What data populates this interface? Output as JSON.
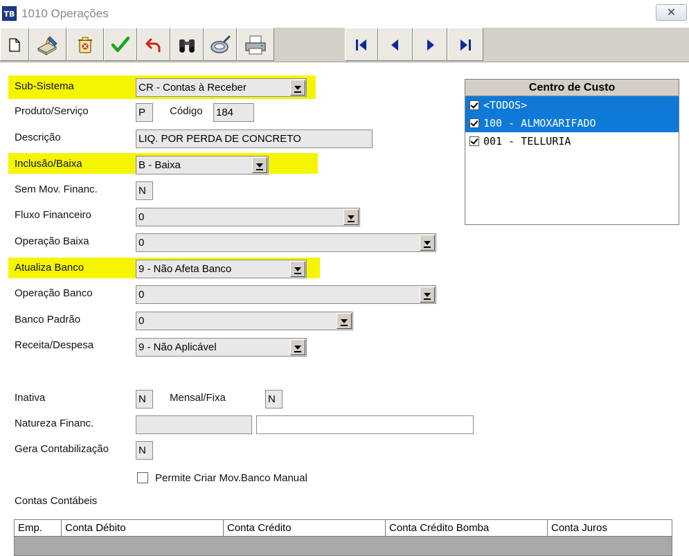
{
  "window": {
    "title": "1010 Operações",
    "app_icon_text": "TB",
    "close_symbol": "✕"
  },
  "toolbar": {
    "buttons": [
      {
        "name": "new-document-icon"
      },
      {
        "name": "edit-icon"
      },
      {
        "name": "delete-icon"
      },
      {
        "name": "confirm-check-icon"
      },
      {
        "name": "undo-icon"
      },
      {
        "name": "search-binoculars-icon"
      },
      {
        "name": "lookup-icon"
      },
      {
        "name": "print-icon"
      }
    ],
    "nav": [
      {
        "name": "first-record-icon"
      },
      {
        "name": "previous-record-icon"
      },
      {
        "name": "next-record-icon"
      },
      {
        "name": "last-record-icon"
      }
    ]
  },
  "form": {
    "sub_sistema": {
      "label": "Sub-Sistema",
      "value": "CR - Contas à Receber"
    },
    "produto_servico": {
      "label": "Produto/Serviço",
      "value": "P"
    },
    "codigo": {
      "label": "Código",
      "value": "184"
    },
    "descricao": {
      "label": "Descrição",
      "value": "LIQ. POR PERDA DE CONCRETO"
    },
    "inclusao_baixa": {
      "label": "Inclusão/Baixa",
      "value": "B - Baixa"
    },
    "sem_mov_financ": {
      "label": "Sem Mov. Financ.",
      "value": "N"
    },
    "fluxo_financeiro": {
      "label": "Fluxo Financeiro",
      "value": "0"
    },
    "operacao_baixa": {
      "label": "Operação Baixa",
      "value": "0"
    },
    "atualiza_banco": {
      "label": "Atualiza Banco",
      "value": "9 - Não Afeta Banco"
    },
    "operacao_banco": {
      "label": "Operação Banco",
      "value": "0"
    },
    "banco_padrao": {
      "label": "Banco Padrão",
      "value": "0"
    },
    "receita_despesa": {
      "label": "Receita/Despesa",
      "value": "9 - Não Aplicável"
    },
    "inativa": {
      "label": "Inativa",
      "value": "N"
    },
    "mensal_fixa": {
      "label": "Mensal/Fixa",
      "value": "N"
    },
    "natureza_financ": {
      "label": "Natureza Financ.",
      "code": "",
      "description": ""
    },
    "gera_contabilizacao": {
      "label": "Gera Contabilização",
      "value": "N"
    },
    "permite_criar": {
      "label": "Permite Criar Mov.Banco Manual",
      "checked": false
    },
    "contas_contabeis": {
      "label": "Contas Contábeis"
    }
  },
  "centro_custo": {
    "title": "Centro de Custo",
    "items": [
      {
        "label": "<TODOS>",
        "checked": true,
        "selected": true
      },
      {
        "label": "100 - ALMOXARIFADO",
        "checked": true,
        "selected": true
      },
      {
        "label": "001 - TELLURIA",
        "checked": true,
        "selected": false
      }
    ]
  },
  "grid": {
    "columns": [
      "Emp.",
      "Conta Débito",
      "Conta Crédito",
      "Conta Crédito Bomba",
      "Conta Juros"
    ]
  },
  "colors": {
    "highlight": "#f5f500",
    "selection": "#0f79d8",
    "toolbar": "#d4d0c8"
  }
}
